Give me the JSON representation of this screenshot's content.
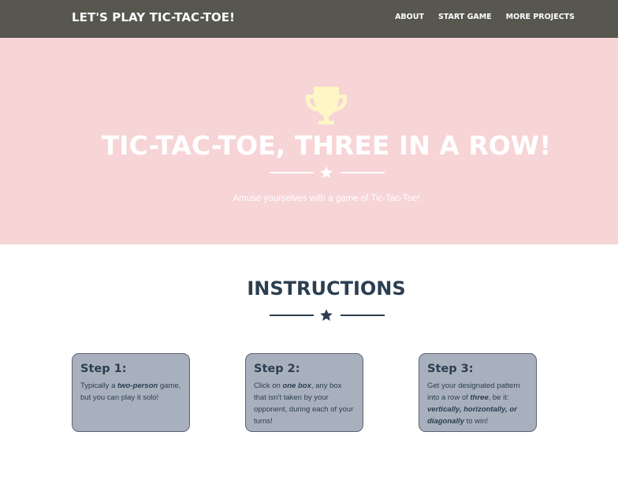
{
  "navbar": {
    "brand": "LET'S PLAY TIC-TAC-TOE!",
    "links": [
      "ABOUT",
      "START GAME",
      "MORE PROJECTS"
    ],
    "background": "#57564f"
  },
  "hero": {
    "icon": "trophy-icon",
    "title": "TIC-TAC-TOE, THREE IN A ROW!",
    "divider_icon": "star-icon",
    "subtitle": "Amuse yourselves with a game of Tic-Tac-Toe!",
    "background": "#f7d4d6",
    "icon_color": "#fef6c5"
  },
  "instructions": {
    "title": "INSTRUCTIONS",
    "divider_icon": "star-icon",
    "accent": "#2c3e50",
    "cards": [
      {
        "title": "Step 1:",
        "parts": [
          {
            "t": "Typically a "
          },
          {
            "t": "two-person",
            "em": true
          },
          {
            "t": " game, but you can play it solo!"
          }
        ]
      },
      {
        "title": "Step 2:",
        "parts": [
          {
            "t": "Click on "
          },
          {
            "t": "one box",
            "em": true
          },
          {
            "t": ", any box that isn't taken by your opponent, during each of your turns!"
          }
        ]
      },
      {
        "title": "Step 3:",
        "parts": [
          {
            "t": "Get your designated pattern into a row of "
          },
          {
            "t": "three",
            "em": true
          },
          {
            "t": ", be it: "
          },
          {
            "t": "vertically, horizontally, or diagonally",
            "em": true
          },
          {
            "t": " to win!"
          }
        ]
      }
    ]
  }
}
